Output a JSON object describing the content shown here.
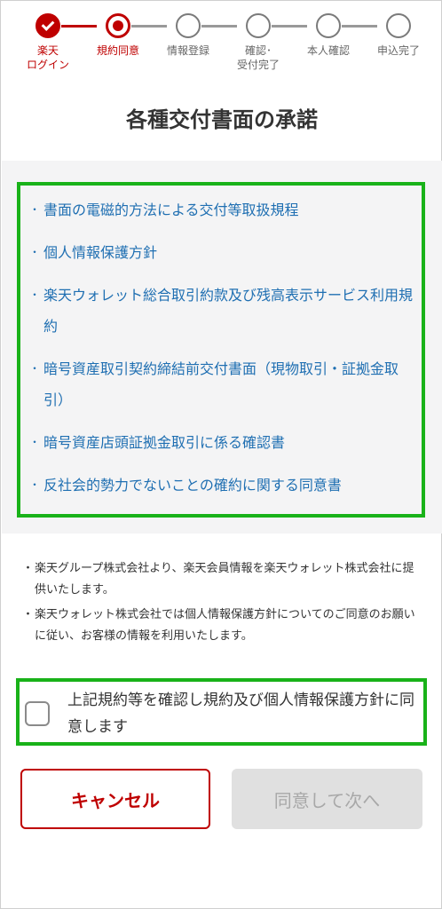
{
  "stepper": {
    "steps": [
      {
        "label": "楽天\nログイン",
        "state": "done"
      },
      {
        "label": "規約同意",
        "state": "current"
      },
      {
        "label": "情報登録",
        "state": "todo"
      },
      {
        "label": "確認･\n受付完了",
        "state": "todo"
      },
      {
        "label": "本人確認",
        "state": "todo"
      },
      {
        "label": "申込完了",
        "state": "todo"
      }
    ]
  },
  "title": "各種交付書面の承諾",
  "documents": [
    "書面の電磁的方法による交付等取扱規程",
    "個人情報保護方針",
    "楽天ウォレット総合取引約款及び残高表示サービス利用規約",
    "暗号資産取引契約締結前交付書面（現物取引・証拠金取引）",
    "暗号資産店頭証拠金取引に係る確認書",
    "反社会的勢力でないことの確約に関する同意書"
  ],
  "notes": [
    "楽天グループ株式会社より、楽天会員情報を楽天ウォレット株式会社に提供いたします。",
    "楽天ウォレット株式会社では個人情報保護方針についてのご同意のお願いに従い、お客様の情報を利用いたします。"
  ],
  "bullet": "・",
  "agree_label": "上記規約等を確認し規約及び個人情報保護方針に同意します",
  "agree_checked": false,
  "buttons": {
    "cancel": "キャンセル",
    "next": "同意して次へ"
  },
  "colors": {
    "brand": "#bf0000",
    "link": "#1f6fb2",
    "highlight": "#19b219",
    "disabled_bg": "#e0e0e0"
  }
}
